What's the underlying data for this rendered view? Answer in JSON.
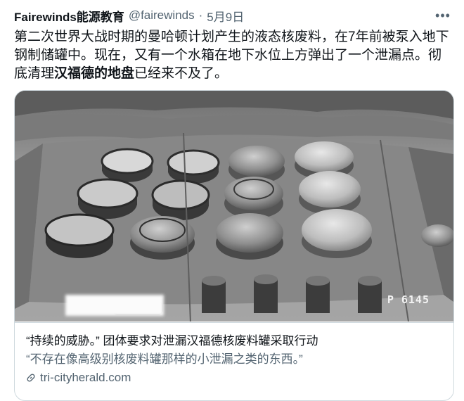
{
  "tweet": {
    "author_name": "Fairewinds能源教育",
    "handle": "@fairewinds",
    "separator": "·",
    "date": "5月9日",
    "more_icon": "more-horizontal-icon",
    "text_part1": "第二次世界大战时期的曼哈顿计划产生的液态核废料，在7年前被泵入地下钢制储罐中。现在，又有一个水箱在地下水位上方弹出了一个泄漏点。彻底清理",
    "text_bold": "汉福德的地盘",
    "text_part2": "已经来不及了。"
  },
  "card": {
    "photo_label": "P 6145",
    "title": "“持续的威胁。” 团体要求对泄漏汉福德核废料罐采取行动",
    "description": "“不存在像高级别核废料罐那样的小泄漏之类的东西。”",
    "domain": "tri-cityherald.com",
    "link_icon": "link-icon"
  }
}
